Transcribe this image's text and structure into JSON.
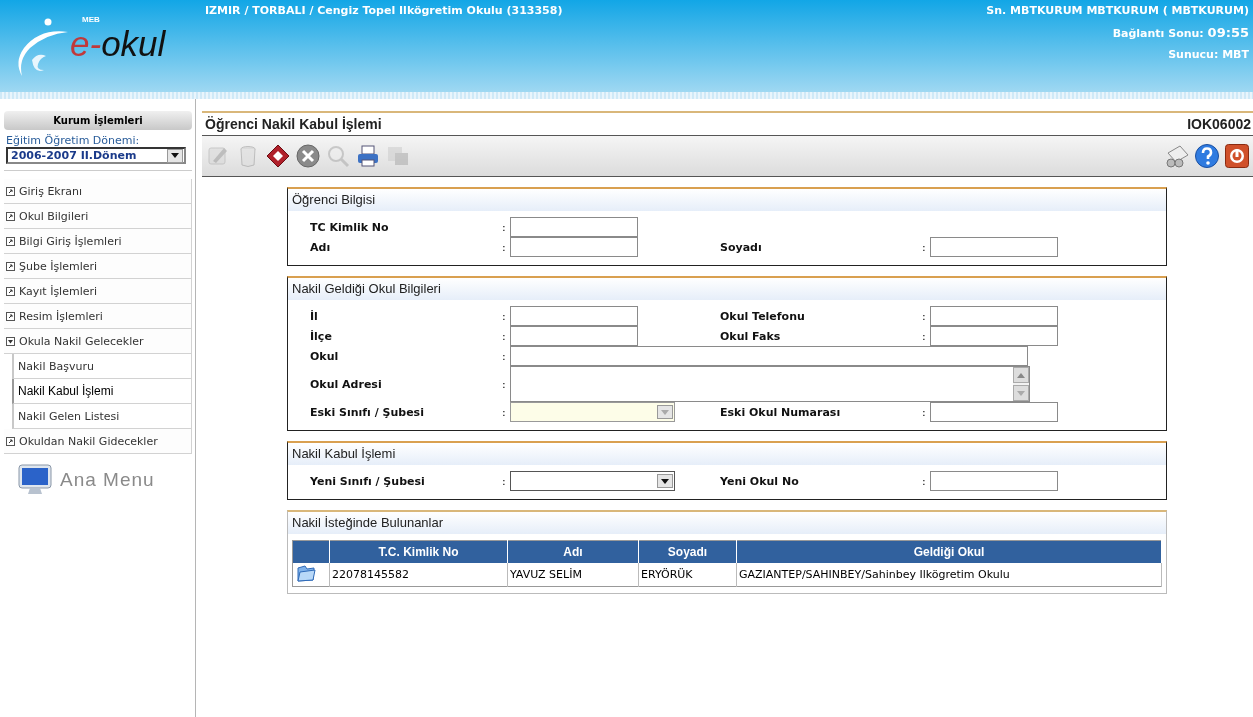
{
  "header": {
    "logo": {
      "mark": "MEB",
      "prefix": "e-",
      "name": "okul"
    },
    "school": "IZMIR / TORBALI / Cengiz Topel Ilkögretim Okulu (313358)",
    "user": "Sn. MBTKURUM MBTKURUM ( MBTKURUM)",
    "session_label": "Bağlantı Sonu:",
    "session_time": "09:55",
    "server": "Sunucu: MBT"
  },
  "sidebar": {
    "title": "Kurum İşlemleri",
    "term_label": "Eğitim Öğretim Dönemi:",
    "term_value": "2006-2007 II.Dönem",
    "items": [
      {
        "label": "Giriş Ekranı",
        "expanded": false
      },
      {
        "label": "Okul Bilgileri",
        "expanded": false
      },
      {
        "label": "Bilgi Giriş İşlemleri",
        "expanded": false
      },
      {
        "label": "Şube İşlemleri",
        "expanded": false
      },
      {
        "label": "Kayıt İşlemleri",
        "expanded": false
      },
      {
        "label": "Resim İşlemleri",
        "expanded": false
      },
      {
        "label": "Okula Nakil Gelecekler",
        "expanded": true,
        "children": [
          {
            "label": "Nakil Başvuru",
            "selected": false
          },
          {
            "label": "Nakil Kabul İşlemi",
            "selected": true
          },
          {
            "label": "Nakil Gelen Listesi",
            "selected": false
          }
        ]
      },
      {
        "label": "Okuldan Nakil Gidecekler",
        "expanded": false
      }
    ],
    "home": "Ana Menu"
  },
  "page": {
    "title": "Öğrenci Nakil Kabul İşlemi",
    "code": "IOK06002",
    "toolbar_left": [
      {
        "kind": "edit",
        "disabled": true
      },
      {
        "kind": "delete",
        "disabled": true
      },
      {
        "kind": "save",
        "disabled": false
      },
      {
        "kind": "cancel",
        "disabled": false
      },
      {
        "kind": "preview",
        "disabled": true
      },
      {
        "kind": "print",
        "disabled": false
      },
      {
        "kind": "export",
        "disabled": true
      }
    ],
    "toolbar_right": [
      {
        "kind": "messages",
        "disabled": false
      },
      {
        "kind": "help",
        "disabled": false
      },
      {
        "kind": "logout",
        "disabled": false
      }
    ],
    "sections": [
      {
        "kind": "form",
        "title": "Öğrenci Bilgisi",
        "rows": [
          [
            {
              "label": "TC Kimlik No",
              "colon": ":",
              "kind": "text"
            }
          ],
          [
            {
              "label": "Adı",
              "colon": ":",
              "kind": "text"
            },
            {
              "label": "Soyadı",
              "colon": ":",
              "kind": "text"
            }
          ]
        ]
      },
      {
        "kind": "form",
        "title": "Nakil Geldiği Okul Bilgileri",
        "rows": [
          [
            {
              "label": "İl",
              "colon": ":",
              "kind": "text"
            },
            {
              "label": "Okul Telefonu",
              "colon": ":",
              "kind": "text"
            }
          ],
          [
            {
              "label": "İlçe",
              "colon": ":",
              "kind": "text"
            },
            {
              "label": "Okul Faks",
              "colon": ":",
              "kind": "text"
            }
          ],
          [
            {
              "label": "Okul",
              "colon": ":",
              "kind": "long"
            }
          ],
          [
            {
              "label": "Okul Adresi",
              "colon": ":",
              "kind": "memo"
            }
          ],
          [
            {
              "label": "Eski Sınıfı / Şubesi",
              "colon": ":",
              "kind": "select",
              "disabled": true
            },
            {
              "label": "Eski Okul Numarası",
              "colon": ":",
              "kind": "text"
            }
          ]
        ]
      },
      {
        "kind": "form",
        "title": "Nakil Kabul İşlemi",
        "rows": [
          [
            {
              "label": "Yeni Sınıfı / Şubesi",
              "colon": ":",
              "kind": "select",
              "disabled": false
            },
            {
              "label": "Yeni Okul No",
              "colon": ":",
              "kind": "text"
            }
          ]
        ]
      },
      {
        "kind": "table",
        "title": "Nakil İsteğinde Bulunanlar",
        "columns": [
          "T.C. Kimlik No",
          "Adı",
          "Soyadı",
          "Geldiği Okul"
        ],
        "rows": [
          {
            "cells": [
              "22078145582",
              "YAVUZ SELİM",
              "ERYÖRÜK",
              "GAZIANTEP/SAHINBEY/Sahinbey Ilkögretim Okulu"
            ]
          }
        ]
      }
    ]
  }
}
